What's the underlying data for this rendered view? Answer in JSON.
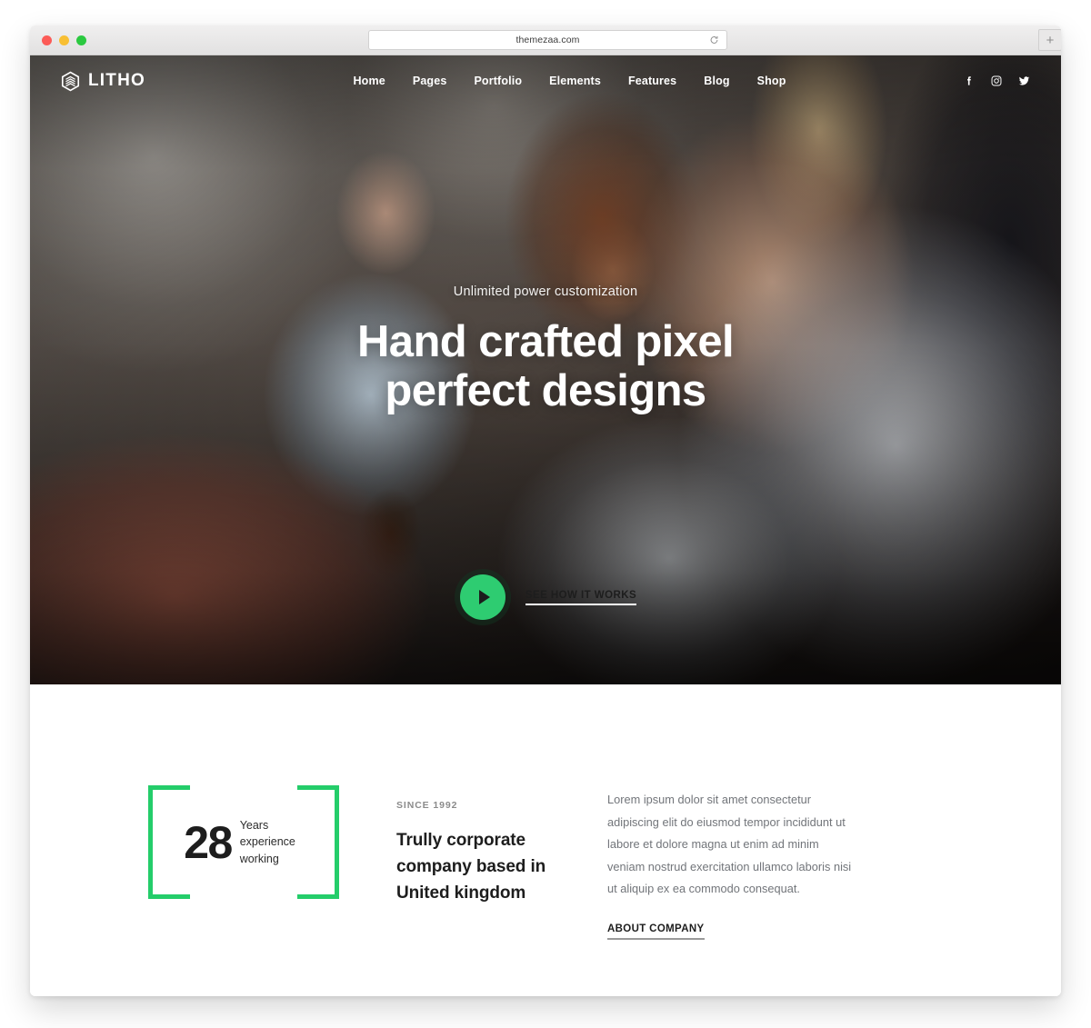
{
  "browser": {
    "url": "themezaa.com",
    "reload_icon": "reload-icon",
    "new_tab_label": "+",
    "traffic_lights": [
      "close-red",
      "minimize-yellow",
      "zoom-green"
    ]
  },
  "site": {
    "brand": {
      "name": "LITHO",
      "icon": "hexagon-layers-logo-icon"
    },
    "nav": {
      "items": [
        {
          "label": "Home"
        },
        {
          "label": "Pages"
        },
        {
          "label": "Portfolio"
        },
        {
          "label": "Elements"
        },
        {
          "label": "Features"
        },
        {
          "label": "Blog"
        },
        {
          "label": "Shop"
        }
      ],
      "social": [
        {
          "name": "facebook-icon"
        },
        {
          "name": "instagram-icon"
        },
        {
          "name": "twitter-icon"
        }
      ]
    },
    "hero": {
      "eyebrow": "Unlimited power customization",
      "title_line1": "Hand crafted pixel",
      "title_line2": "perfect designs",
      "video_cta": {
        "label": "SEE HOW IT WORKS",
        "play_icon": "play-icon"
      }
    },
    "about": {
      "stat": {
        "number": "28",
        "caption": "Years experience working"
      },
      "since": "SINCE 1992",
      "heading": "Trully corporate company based in United kingdom",
      "paragraph": "Lorem ipsum dolor sit amet consectetur adipiscing elit do eiusmod tempor incididunt ut labore et dolore magna ut enim ad minim veniam nostrud exercitation ullamco laboris nisi ut aliquip ex ea commodo consequat.",
      "link_label": "ABOUT COMPANY"
    }
  },
  "colors": {
    "accent_green": "#2ecc71",
    "bracket_green": "#24cd6a",
    "text_dark": "#1d1d1d",
    "text_muted": "#72757a"
  }
}
